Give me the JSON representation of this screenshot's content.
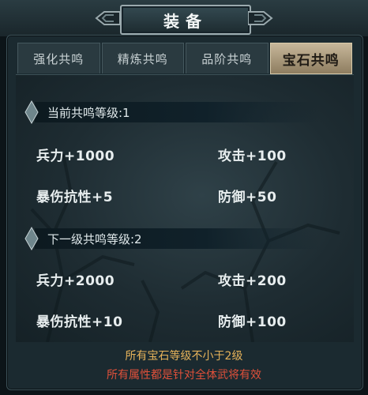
{
  "window": {
    "title": "装备"
  },
  "tabs": [
    {
      "label": "强化共鸣"
    },
    {
      "label": "精炼共鸣"
    },
    {
      "label": "品阶共鸣"
    },
    {
      "label": "宝石共鸣"
    }
  ],
  "current": {
    "header": "当前共鸣等级:1",
    "stats": [
      "兵力+1000",
      "攻击+100",
      "暴伤抗性+5",
      "防御+50"
    ]
  },
  "next": {
    "header": "下一级共鸣等级:2",
    "stats": [
      "兵力+2000",
      "攻击+200",
      "暴伤抗性+10",
      "防御+100"
    ]
  },
  "footer": {
    "requirement": "所有宝石等级不小于2级",
    "note": "所有属性都是针对全体武将有效"
  },
  "colors": {
    "accent_gold": "#e5b25a",
    "warning_red": "#e0503a",
    "active_tab": "#c7b79a"
  }
}
